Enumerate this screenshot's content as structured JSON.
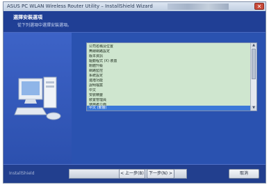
{
  "window": {
    "title": "ASUS PC WLAN Wireless Router Utility – InstallShield Wizard",
    "close_label": "✕"
  },
  "header": {
    "title": "選擇安裝選項",
    "subtitle": "從下列選項中選擇安裝選項。"
  },
  "list": {
    "items": [
      "公司名稱及位置",
      "無線網路設定",
      "版本資訊",
      "驅動程式 (X) 裝置",
      "韌體升級",
      "網路監控",
      "系統設定",
      "進階功能",
      "說明檔案",
      "中文",
      "安裝精靈",
      "裝置管理員",
      "使用者介面",
      "系統",
      "中文 (繁體)"
    ],
    "selected_index": 14
  },
  "footer": {
    "brand": "InstallShield",
    "back_label": "< 上一步(B)",
    "next_label": "下一步(N) >",
    "cancel_label": "取消"
  },
  "colors": {
    "background": "#2a52b0",
    "list_background": "#cfe6cf",
    "selection": "#3b78d8"
  }
}
